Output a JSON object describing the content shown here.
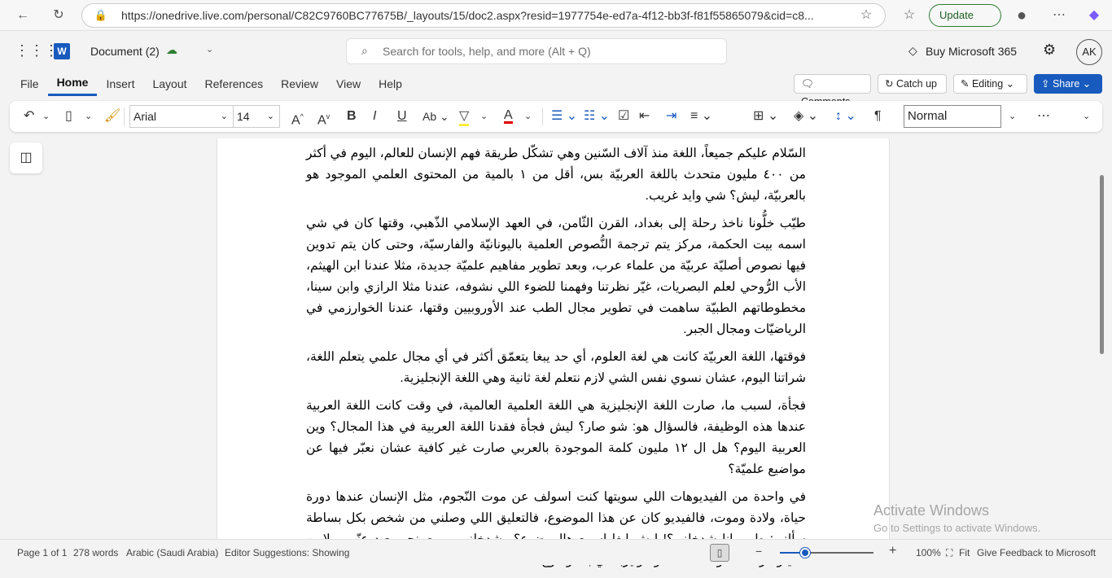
{
  "browser": {
    "url": "https://onedrive.live.com/personal/C82C9760BC77675B/_layouts/15/doc2.aspx?resid=1977754e-ed7a-4f12-bb3f-f81f55865079&cid=c8...",
    "update_label": "Update"
  },
  "header": {
    "doc_title": "Document (2)",
    "search_placeholder": "Search for tools, help, and more (Alt + Q)",
    "buy_label": "Buy Microsoft 365",
    "avatar": "AK"
  },
  "menu": {
    "tabs": [
      "File",
      "Home",
      "Insert",
      "Layout",
      "References",
      "Review",
      "View",
      "Help"
    ],
    "active": "Home",
    "comments": "Comments",
    "catch_up": "Catch up",
    "editing": "Editing",
    "share": "Share"
  },
  "ribbon": {
    "font": "Arial",
    "size": "14",
    "style": "Normal"
  },
  "document": {
    "paragraphs": [
      "السّلام عليكم جميعاً، اللغة منذ آلاف السّنين وهي تشكّل طريقة فهم الإنسان للعالم، اليوم في أكثر من ٤٠٠ مليون متحدث باللغة العربيّة بس، أقل من ١ بالمية من المحتوى العلمي الموجود هو بالعربيّة، ليش؟ شي وايد غريب.",
      "طيّب خلُّونا ناخذ رحلة إلى بغداد، القرن الثّامن، في العهد الإسلامي الذّهبي، وقتها كان في شي اسمه بيت الحكمة، مركز يتم ترجمة النُّصوص العلمية باليونانيّة والفارسيّة، وحتى كان يتم تدوين فيها نصوص أصليّة عربيّة من علماء عرب، وبعد تطوير مفاهيم علميّة جديدة، مثلا عندنا ابن الهيثم، الأب الرُّوحي لعلم البصريات، غيّر نظرتنا وفهمنا للضوء اللي نشوفه، عندنا مثلا الرازي وابن سينا، مخطوطاتهم الطبيّة ساهمت في تطوير مجال الطب عند الأوروبيين وقتها، عندنا الخوارزمي في الرياضيّات ومجال الجبر.",
      "فوقتها، اللغة العربيّة كانت هي لغة العلوم، أي حد يبغا يتعمّق أكثر في أي مجال علمي يتعلم اللغة، شراتنا اليوم، عشان نسوي نفس الشي لازم نتعلم لغة ثانية وهي اللغة الإنجليزية.",
      "فجأة، لسبب ما، صارت اللغة الإنجليزية هي اللغة العلمية العالمية، في وقت كانت اللغة العربية عندها هذه الوظيفة، فالسؤال هو: شو صار؟ ليش فجأة فقدنا اللغة العربية في هذا المجال؟ وين العربية اليوم؟ هل ال ١٢ مليون كلمة الموجودة بالعربي صارت غير كافية عشان نعبّر فيها عن مواضيع علميّة؟",
      "في واحدة من الفيديوهات اللي سويتها كنت اسولف عن موت النّجوم، مثل الإنسان عندها دورة حياة، ولادة وموت، فالفيديو كان عن هذا الموضوع، فالتعليق اللي وصلني من شخص بكل بساطة سألني: طيب انا شدخلني؟! ليش ابغا اسمع هالموضوع؟ وشدخلني بموت نجم بعيد عنّي بملايين الكيلومترات؟ شو استفدت؟ وشو يربطني بالموضوع أصلا؟"
    ]
  },
  "status": {
    "page": "Page 1 of 1",
    "words": "278 words",
    "language": "Arabic (Saudi Arabia)",
    "editor": "Editor Suggestions: Showing",
    "zoom": "100%",
    "zoom_level": 100,
    "fit": "Fit",
    "feedback": "Give Feedback to Microsoft"
  },
  "watermark": {
    "line1": "Activate Windows",
    "line2": "Go to Settings to activate Windows."
  },
  "colors": {
    "accent": "#185abd"
  }
}
